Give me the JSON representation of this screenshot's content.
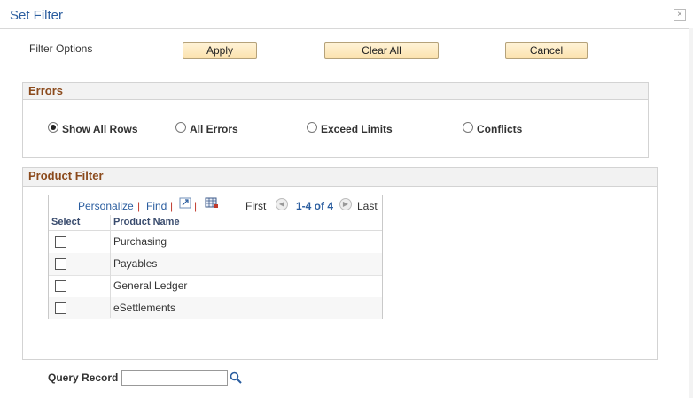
{
  "dialog": {
    "title": "Set Filter",
    "close_glyph": "×"
  },
  "filter_options": {
    "label": "Filter Options",
    "apply_label": "Apply",
    "clear_all_label": "Clear All",
    "cancel_label": "Cancel"
  },
  "errors": {
    "title": "Errors",
    "options": [
      {
        "label": "Show All Rows",
        "checked": true
      },
      {
        "label": "All Errors",
        "checked": false
      },
      {
        "label": "Exceed Limits",
        "checked": false
      },
      {
        "label": "Conflicts",
        "checked": false
      }
    ]
  },
  "product_filter": {
    "title": "Product Filter",
    "nav": {
      "personalize": "Personalize",
      "sep1": "|",
      "find": "Find",
      "sep2": "|",
      "sep3": "|",
      "first": "First",
      "range": "1-4 of 4",
      "last": "Last"
    },
    "columns": {
      "select": "Select",
      "product_name": "Product Name"
    },
    "rows": [
      {
        "product_name": "Purchasing",
        "selected": false
      },
      {
        "product_name": "Payables",
        "selected": false
      },
      {
        "product_name": "General Ledger",
        "selected": false
      },
      {
        "product_name": "eSettlements",
        "selected": false
      }
    ]
  },
  "query": {
    "label": "Query Record",
    "value": "",
    "lookup_icon": "magnifier-icon"
  },
  "colors": {
    "title_blue": "#2a5d9f",
    "section_brown": "#8b4a1c",
    "button_fill": "#fbe2ad"
  }
}
